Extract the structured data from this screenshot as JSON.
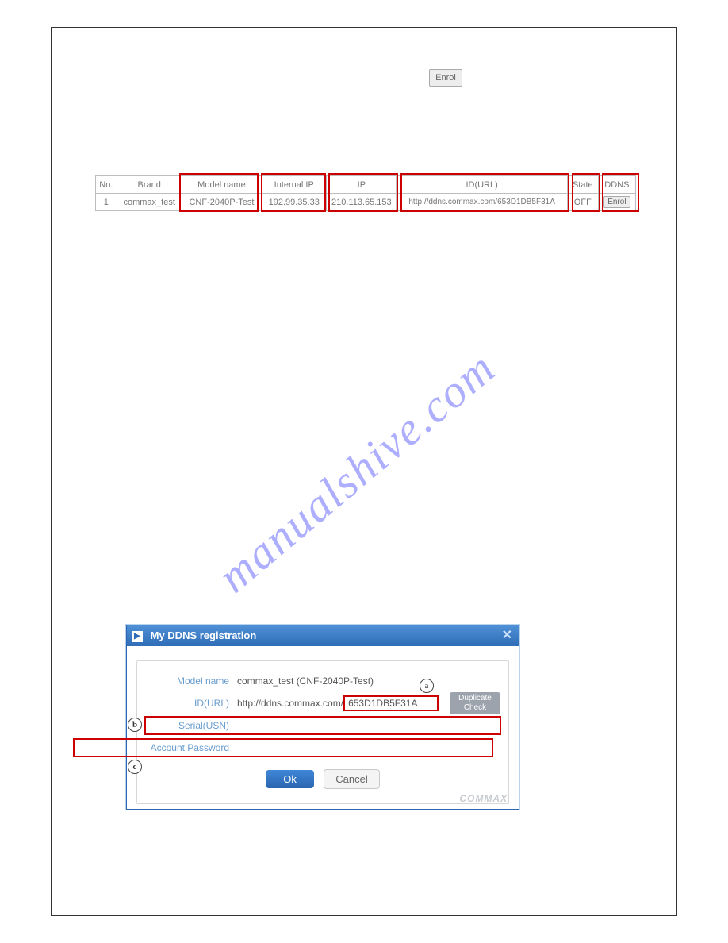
{
  "top_button": {
    "label": "Enrol"
  },
  "watermark": "manualshive.com",
  "table": {
    "headers": {
      "no": "No.",
      "brand": "Brand",
      "model": "Model name",
      "internal_ip": "Internal IP",
      "ip": "IP",
      "url": "ID(URL)",
      "state": "State",
      "ddns": "DDNS"
    },
    "row": {
      "no": "1",
      "brand": "commax_test",
      "model": "CNF-2040P-Test",
      "internal_ip": "192.99.35.33",
      "ip": "210.113.65.153",
      "url": "http://ddns.commax.com/653D1DB5F31A",
      "state": "OFF",
      "ddns_btn": "Enrol"
    }
  },
  "dialog": {
    "title": "My DDNS registration",
    "close": "✕",
    "labels": {
      "model": "Model name",
      "url": "ID(URL)",
      "serial": "Serial(USN)",
      "password": "Account Password"
    },
    "values": {
      "model": "commax_test (CNF-2040P-Test)",
      "url_prefix": "http://ddns.commax.com/",
      "url_id": "653D1DB5F31A"
    },
    "dup_btn_l1": "Duplicate",
    "dup_btn_l2": "Check",
    "ok": "Ok",
    "cancel": "Cancel",
    "annot": {
      "a": "a",
      "b": "b",
      "c": "c"
    },
    "logo": "COMMAX"
  }
}
